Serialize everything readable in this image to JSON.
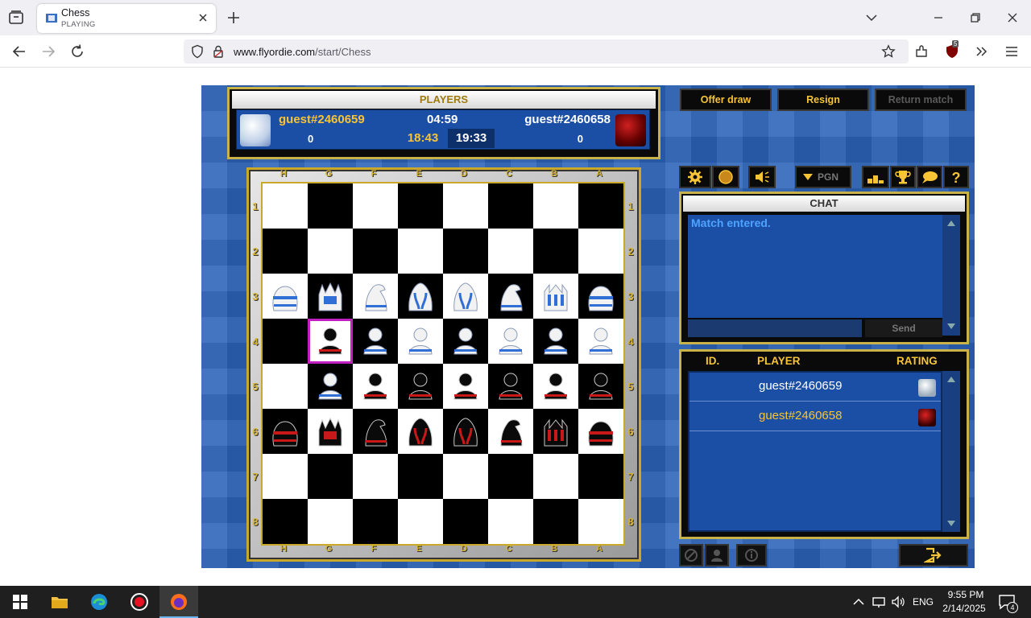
{
  "browser": {
    "tab": {
      "title": "Chess",
      "subtitle": "PLAYING"
    },
    "url": {
      "domain": "www.flyordie.com",
      "path": "/start/Chess"
    },
    "extension_badge": "5"
  },
  "game": {
    "players_panel": {
      "header": "PLAYERS",
      "player1": {
        "name": "guest#2460659",
        "score": "0",
        "time": "18:43"
      },
      "player2": {
        "name": "guest#2460658",
        "score": "0",
        "time": "19:33"
      },
      "move_clock": "04:59"
    },
    "actions": {
      "offer_draw": "Offer draw",
      "resign": "Resign",
      "return_match": "Return match"
    },
    "toolbar": {
      "pgn": "PGN"
    },
    "board": {
      "files": [
        "H",
        "G",
        "F",
        "E",
        "D",
        "C",
        "B",
        "A"
      ],
      "ranks": [
        "1",
        "2",
        "3",
        "4",
        "5",
        "6",
        "7",
        "8"
      ],
      "highlight": "G4",
      "rows": [
        [
          "",
          "",
          "",
          "",
          "",
          "",
          "",
          ""
        ],
        [
          "",
          "",
          "",
          "",
          "",
          "",
          "",
          ""
        ],
        [
          "wR",
          "wQ",
          "wN",
          "wB",
          "wB",
          "wN",
          "wK",
          "wR"
        ],
        [
          "",
          "bP",
          "wP",
          "wP",
          "wP",
          "wP",
          "wP",
          "wP"
        ],
        [
          "",
          "wP",
          "bP",
          "bP",
          "bP",
          "bP",
          "bP",
          "bP"
        ],
        [
          "bR",
          "bQ",
          "bN",
          "bB",
          "bB",
          "bN",
          "bK",
          "bR"
        ],
        [
          "",
          "",
          "",
          "",
          "",
          "",
          "",
          ""
        ],
        [
          "",
          "",
          "",
          "",
          "",
          "",
          "",
          ""
        ]
      ]
    },
    "chat": {
      "header": "CHAT",
      "messages": [
        "Match entered."
      ],
      "send_label": "Send"
    },
    "player_list": {
      "headers": {
        "id": "ID.",
        "player": "PLAYER",
        "rating": "RATING"
      },
      "rows": [
        {
          "name": "guest#2460659",
          "color": "#ffffff",
          "side": "white"
        },
        {
          "name": "guest#2460658",
          "color": "#f7c435",
          "side": "black"
        }
      ]
    }
  },
  "taskbar": {
    "lang": "ENG",
    "time": "9:55 PM",
    "date": "2/14/2025",
    "notifications": "4"
  },
  "colors": {
    "accent_gold": "#f7c435",
    "board_blue": "#1b4fa6",
    "highlight": "#c020c0"
  }
}
